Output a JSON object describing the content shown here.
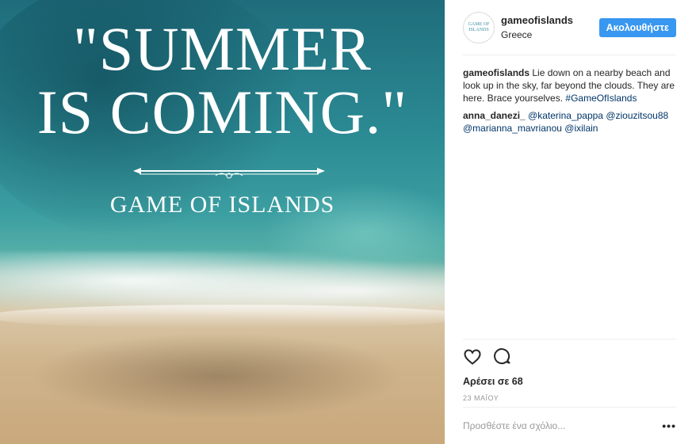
{
  "image": {
    "headline_line1": "\"SUMMER",
    "headline_line2": "IS COMING.\"",
    "brand": "GAME OF ISLANDS"
  },
  "header": {
    "avatar_text": "GAME OF ISLANDS",
    "username": "gameofislands",
    "location": "Greece",
    "follow_label": "Ακολουθήστε"
  },
  "caption": {
    "username": "gameofislands",
    "text": "Lie down on a nearby beach and look up in the sky, far beyond the clouds. They are here. Brace yourselves.",
    "hashtag": "#GameOfIslands"
  },
  "comment": {
    "username": "anna_danezi_",
    "mentions": [
      "@katerina_pappa",
      "@ziouzitsou88",
      "@marianna_mavrianou",
      "@ixilain"
    ]
  },
  "actions": {
    "like_icon": "heart-icon",
    "comment_icon": "comment-bubble-icon",
    "likes_text": "Αρέσει σε 68",
    "date": "23 ΜΑΪΟΥ"
  },
  "add_comment": {
    "placeholder": "Προσθέστε ένα σχόλιο...",
    "more_label": "•••"
  },
  "colors": {
    "accent": "#3897f0",
    "link": "#003569",
    "muted": "#999999"
  }
}
